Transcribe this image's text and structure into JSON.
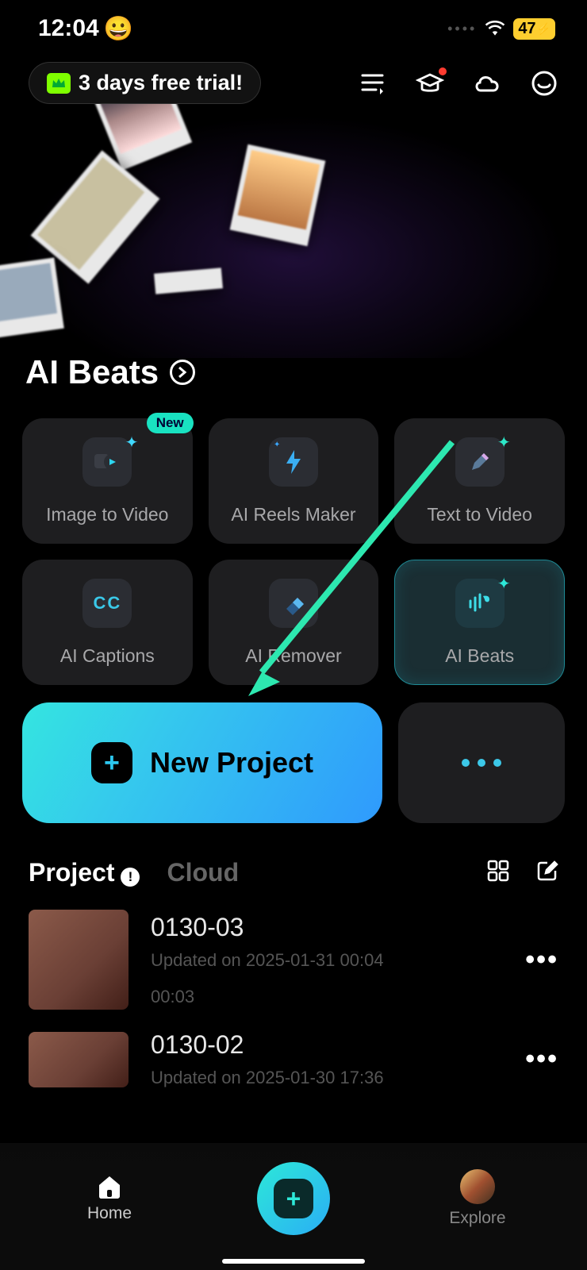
{
  "status": {
    "time": "12:04",
    "emoji": "😀",
    "battery": "47"
  },
  "header": {
    "trial_label": "3 days free trial!"
  },
  "section": {
    "title": "AI Beats"
  },
  "features": [
    {
      "label": "Image to Video",
      "badge": "New",
      "icon": "image-to-video"
    },
    {
      "label": "AI Reels Maker",
      "icon": "bolt"
    },
    {
      "label": "Text  to Video",
      "icon": "pencil"
    },
    {
      "label": "AI Captions",
      "icon": "cc"
    },
    {
      "label": "AI Remover",
      "icon": "eraser"
    },
    {
      "label": "AI Beats",
      "icon": "beats",
      "highlighted": true
    }
  ],
  "actions": {
    "new_project": "New Project"
  },
  "tabs": {
    "project": "Project",
    "cloud": "Cloud"
  },
  "projects": [
    {
      "title": "0130-03",
      "updated": "Updated on 2025-01-31 00:04",
      "duration": "00:03"
    },
    {
      "title": "0130-02",
      "updated": "Updated on 2025-01-30 17:36",
      "duration": ""
    }
  ],
  "nav": {
    "home": "Home",
    "explore": "Explore"
  }
}
